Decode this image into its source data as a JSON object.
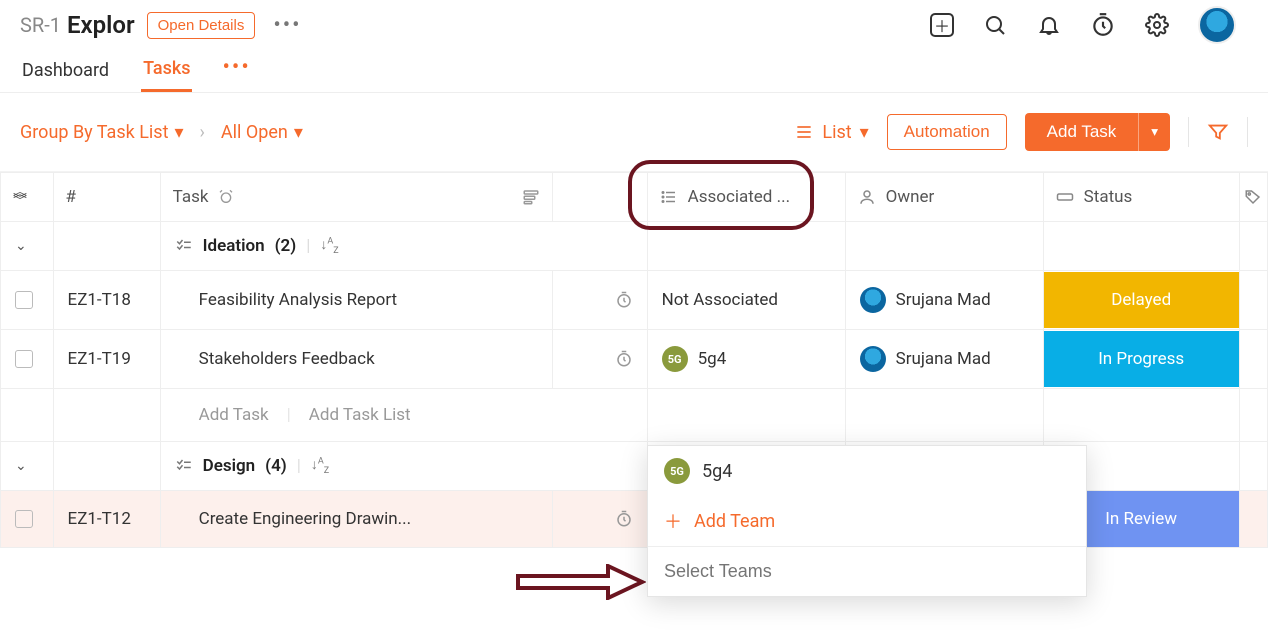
{
  "header": {
    "breadcrumb_id": "SR-1",
    "breadcrumb_title": "Explor",
    "open_details": "Open Details"
  },
  "tabs": {
    "dashboard": "Dashboard",
    "tasks": "Tasks"
  },
  "toolbar": {
    "group_by": "Group By Task List",
    "filter_scope": "All Open",
    "view_label": "List",
    "automation": "Automation",
    "add_task": "Add Task"
  },
  "columns": {
    "id": "#",
    "task": "Task",
    "associated": "Associated ...",
    "owner": "Owner",
    "status": "Status"
  },
  "groups": [
    {
      "name": "Ideation",
      "count": "(2)",
      "rows": [
        {
          "id": "EZ1-T18",
          "task": "Feasibility Analysis Report",
          "associated_text": "Not Associated",
          "associated_chip": null,
          "owner": "Srujana Mad",
          "status_label": "Delayed",
          "status_class": "status-delayed"
        },
        {
          "id": "EZ1-T19",
          "task": "Stakeholders Feedback",
          "associated_text": "5g4",
          "associated_chip": "5G",
          "owner": "Srujana Mad",
          "status_label": "In Progress",
          "status_class": "status-inprogress"
        }
      ]
    },
    {
      "name": "Design",
      "count": "(4)",
      "rows": [
        {
          "id": "EZ1-T12",
          "task": "Create Engineering Drawin...",
          "associated_text": "",
          "associated_chip": null,
          "owner": "",
          "status_label": "In Review",
          "status_class": "status-inreview"
        }
      ]
    }
  ],
  "add_row": {
    "add_task": "Add Task",
    "add_task_list": "Add Task List"
  },
  "dropdown": {
    "team_chip": "5G",
    "team_name": "5g4",
    "add_team": "Add Team",
    "placeholder": "Select Teams"
  }
}
